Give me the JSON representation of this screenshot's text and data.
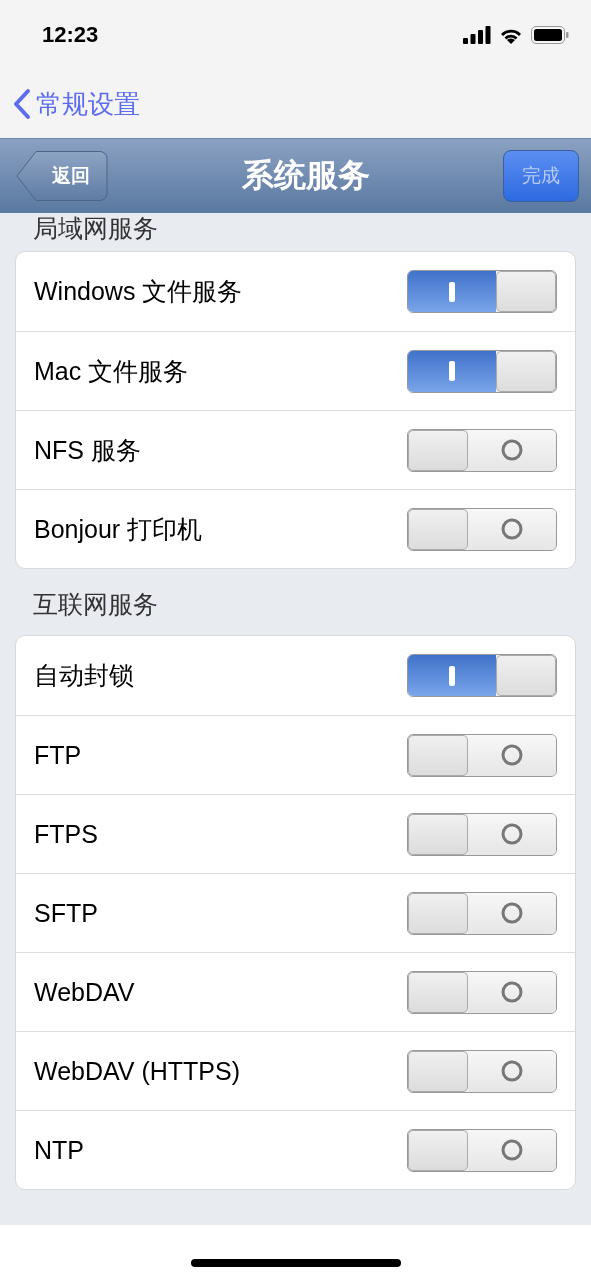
{
  "status_bar": {
    "time": "12:23"
  },
  "back_link": {
    "label": "常规设置"
  },
  "nav_bar": {
    "back": "返回",
    "title": "系统服务",
    "done": "完成"
  },
  "sections": [
    {
      "title": "局域网服务",
      "items": [
        {
          "label": "Windows 文件服务",
          "on": true
        },
        {
          "label": "Mac 文件服务",
          "on": true
        },
        {
          "label": "NFS 服务",
          "on": false
        },
        {
          "label": "Bonjour 打印机",
          "on": false
        }
      ]
    },
    {
      "title": "互联网服务",
      "items": [
        {
          "label": "自动封锁",
          "on": true
        },
        {
          "label": "FTP",
          "on": false
        },
        {
          "label": "FTPS",
          "on": false
        },
        {
          "label": "SFTP",
          "on": false
        },
        {
          "label": "WebDAV",
          "on": false
        },
        {
          "label": "WebDAV (HTTPS)",
          "on": false
        },
        {
          "label": "NTP",
          "on": false
        }
      ]
    }
  ]
}
